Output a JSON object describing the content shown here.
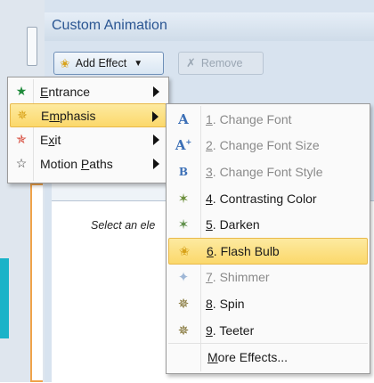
{
  "pane": {
    "title": "Custom Animation",
    "add_effect_label": "Add Effect",
    "remove_label": "Remove",
    "hint_text": "Select an ele"
  },
  "main_menu": {
    "items": [
      {
        "pre": "",
        "ul": "E",
        "post": "ntrance",
        "icon": "entrance-star-icon",
        "has_submenu": true
      },
      {
        "pre": "E",
        "ul": "m",
        "post": "phasis",
        "icon": "emphasis-star-icon",
        "has_submenu": true,
        "highlighted": true
      },
      {
        "pre": "E",
        "ul": "x",
        "post": "it",
        "icon": "exit-star-icon",
        "has_submenu": true
      },
      {
        "pre": "Motion ",
        "ul": "P",
        "post": "aths",
        "icon": "motion-paths-star-icon",
        "has_submenu": true
      }
    ]
  },
  "sub_menu": {
    "items": [
      {
        "num": "1",
        "label": ". Change Font",
        "icon": "change-font-icon",
        "disabled": true
      },
      {
        "num": "2",
        "label": ". Change Font Size",
        "icon": "change-font-size-icon",
        "disabled": true
      },
      {
        "num": "3",
        "label": ". Change Font Style",
        "icon": "change-font-style-icon",
        "disabled": true
      },
      {
        "num": "4",
        "label": ". Contrasting Color",
        "icon": "contrasting-color-icon",
        "disabled": false
      },
      {
        "num": "5",
        "label": ". Darken",
        "icon": "darken-icon",
        "disabled": false
      },
      {
        "num": "6",
        "label": ". Flash Bulb",
        "icon": "flash-bulb-icon",
        "disabled": false,
        "highlighted": true
      },
      {
        "num": "7",
        "label": ". Shimmer",
        "icon": "shimmer-icon",
        "disabled": true
      },
      {
        "num": "8",
        "label": ". Spin",
        "icon": "spin-icon",
        "disabled": false
      },
      {
        "num": "9",
        "label": ". Teeter",
        "icon": "teeter-icon",
        "disabled": false
      }
    ],
    "more_pre": "",
    "more_ul": "M",
    "more_post": "ore Effects..."
  },
  "colors": {
    "highlight": "#fbd86b",
    "title_blue": "#2a5592",
    "pane_bg": "#d8e3ef"
  }
}
